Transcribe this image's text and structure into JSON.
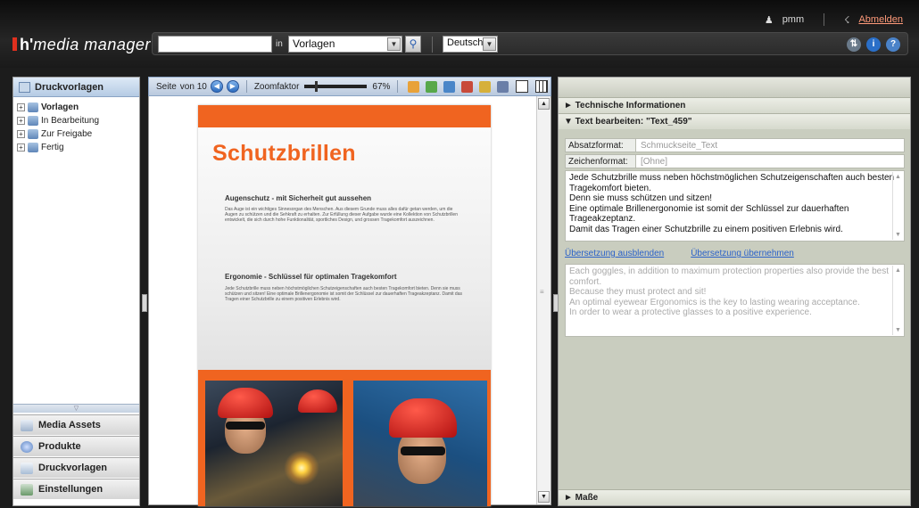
{
  "header": {
    "user": "pmm",
    "logout": "Abmelden",
    "logo_h": "h'",
    "logo_rest": "media manager",
    "search_in": "in",
    "search_scope": "Vorlagen",
    "language": "Deutsch"
  },
  "left": {
    "title": "Druckvorlagen",
    "tree": [
      {
        "label": "Vorlagen"
      },
      {
        "label": "In Bearbeitung"
      },
      {
        "label": "Zur Freigabe"
      },
      {
        "label": "Fertig"
      }
    ],
    "accordion": [
      {
        "label": "Media Assets",
        "icon": "media-assets-icon"
      },
      {
        "label": "Produkte",
        "icon": "products-icon"
      },
      {
        "label": "Druckvorlagen",
        "icon": "print-templates-icon"
      },
      {
        "label": "Einstellungen",
        "icon": "settings-icon"
      }
    ]
  },
  "viewer": {
    "page_label": "Seite",
    "page_of": "von 10",
    "zoom_label": "Zoomfaktor",
    "zoom_value": "67%",
    "zoom_fraction": 0.67,
    "doc": {
      "title": "Schutzbrillen",
      "h1": "Augenschutz - mit Sicherheit gut aussehen",
      "p1": "Das Auge ist ein wichtiges Sinnesorgan des Menschen. Aus diesem Grunde muss alles dafür getan werden, um die Augen zu schützen und die Sehkraft zu erhalten. Zur Erfüllung dieser Aufgabe wurde eine Kollektion von Schutzbrillen entwickelt, die sich durch hohe Funktionalität, sportliches Design, und grossen Tragekomfort auszeichnen.",
      "h2": "Ergonomie - Schlüssel für optimalen Tragekomfort",
      "p2": "Jede Schutzbrille muss neben höchstmöglichen Schutzeigenschaften auch besten Tragekomfort bieten. Denn sie muss schützen und sitzen! Eine optimale Brillenergonomie ist somit der Schlüssel zur dauerhaften Trageakzeptanz. Damit das Tragen einer Schutzbrille zu einem positiven Erlebnis wird."
    }
  },
  "right": {
    "section_tech": "► Technische Informationen",
    "section_edit": "▼ Text bearbeiten: \"Text_459\"",
    "absatz_label": "Absatzformat:",
    "absatz_value": "Schmuckseite_Text",
    "zeichen_label": "Zeichenformat:",
    "zeichen_value": "[Ohne]",
    "text": "Jede Schutzbrille muss neben höchstmöglichen Schutzeigenschaften auch besten Tragekomfort bieten.\nDenn sie muss schützen und sitzen!\nEine optimale Brillenergonomie ist somit der Schlüssel zur dauerhaften Trageakzeptanz.\nDamit das Tragen einer Schutzbrille zu einem positiven Erlebnis wird.",
    "link_hide": "Übersetzung ausblenden",
    "link_apply": "Übersetzung übernehmen",
    "translation": "Each goggles, in addition to maximum protection properties also provide the best comfort.\nBecause they must protect and sit!\nAn optimal eyewear Ergonomics is the key to lasting wearing acceptance.\nIn order to wear a protective glasses to a positive experience.",
    "section_masse": "► Maße"
  }
}
